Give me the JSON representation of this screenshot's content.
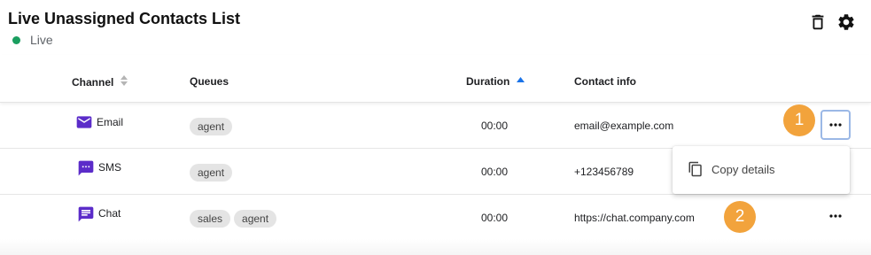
{
  "header": {
    "title": "Live Unassigned Contacts List",
    "status_label": "Live",
    "status_color": "#1a9e5f",
    "actions": [
      {
        "icon": "trash-icon"
      },
      {
        "icon": "gear-icon"
      }
    ]
  },
  "columns": {
    "channel": "Channel",
    "queues": "Queues",
    "duration": "Duration",
    "contact_info": "Contact info",
    "channel_sort": "unsorted",
    "duration_sort": "ascending"
  },
  "rows": [
    {
      "channel": "Email",
      "channel_icon": "email-icon",
      "queues": [
        "agent"
      ],
      "duration": "00:00",
      "contact": "email@example.com"
    },
    {
      "channel": "SMS",
      "channel_icon": "sms-icon",
      "queues": [
        "agent"
      ],
      "duration": "00:00",
      "contact": "+123456789"
    },
    {
      "channel": "Chat",
      "channel_icon": "chat-icon",
      "queues": [
        "sales",
        "agent"
      ],
      "duration": "00:00",
      "contact": "https://chat.company.com"
    }
  ],
  "context_menu": {
    "items": [
      {
        "label": "Copy details",
        "icon": "copy-icon"
      }
    ]
  },
  "annotations": [
    "1",
    "2"
  ],
  "colors": {
    "accent_purple": "#5b2cc9",
    "badge_orange": "#f2a33c",
    "sort_active": "#1a73e8",
    "focus_outline": "#9bb8e6"
  }
}
